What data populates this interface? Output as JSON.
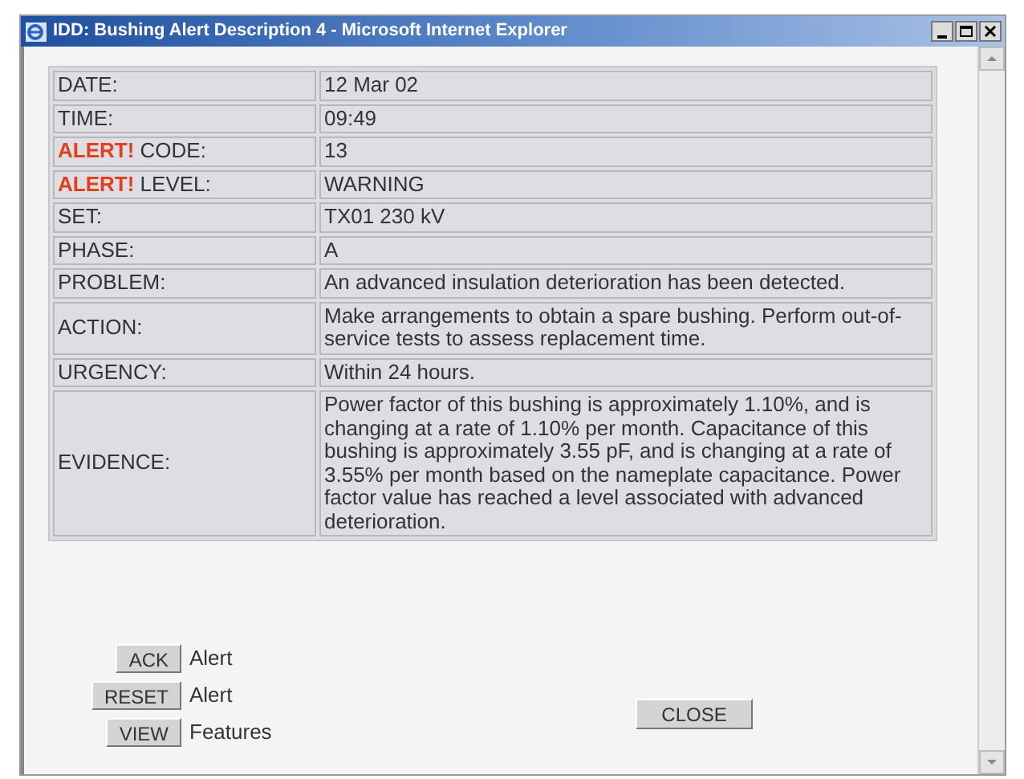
{
  "window": {
    "title": "IDD: Bushing Alert Description 4 - Microsoft Internet Explorer"
  },
  "table": {
    "rows": [
      {
        "label": "DATE:",
        "value": "12 Mar 02"
      },
      {
        "label": "TIME:",
        "value": "09:49"
      },
      {
        "prefix": "ALERT!",
        "label": "CODE:",
        "value": "13"
      },
      {
        "prefix": "ALERT!",
        "label": "LEVEL:",
        "value": "WARNING"
      },
      {
        "label": "SET:",
        "value": "TX01 230 kV"
      },
      {
        "label": "PHASE:",
        "value": "A"
      },
      {
        "label": "PROBLEM:",
        "value": "An advanced insulation deterioration has been detected."
      },
      {
        "label": "ACTION:",
        "value": "Make arrangements to obtain a spare bushing. Perform out-of-service tests to assess replacement time."
      },
      {
        "label": "URGENCY:",
        "value": "Within 24 hours."
      },
      {
        "label": "EVIDENCE:",
        "value": "Power factor of this bushing is approximately 1.10%, and is changing at a rate of 1.10% per month. Capacitance of this bushing is approximately 3.55 pF, and is changing at a rate of 3.55% per month based on the nameplate capacitance. Power factor value has reached a level associated with advanced deterioration."
      }
    ]
  },
  "actions": [
    {
      "button": "ACK",
      "text": "Alert"
    },
    {
      "button": "RESET",
      "text": "Alert"
    },
    {
      "button": "VIEW",
      "text": "Features"
    }
  ],
  "close_button": "CLOSE"
}
